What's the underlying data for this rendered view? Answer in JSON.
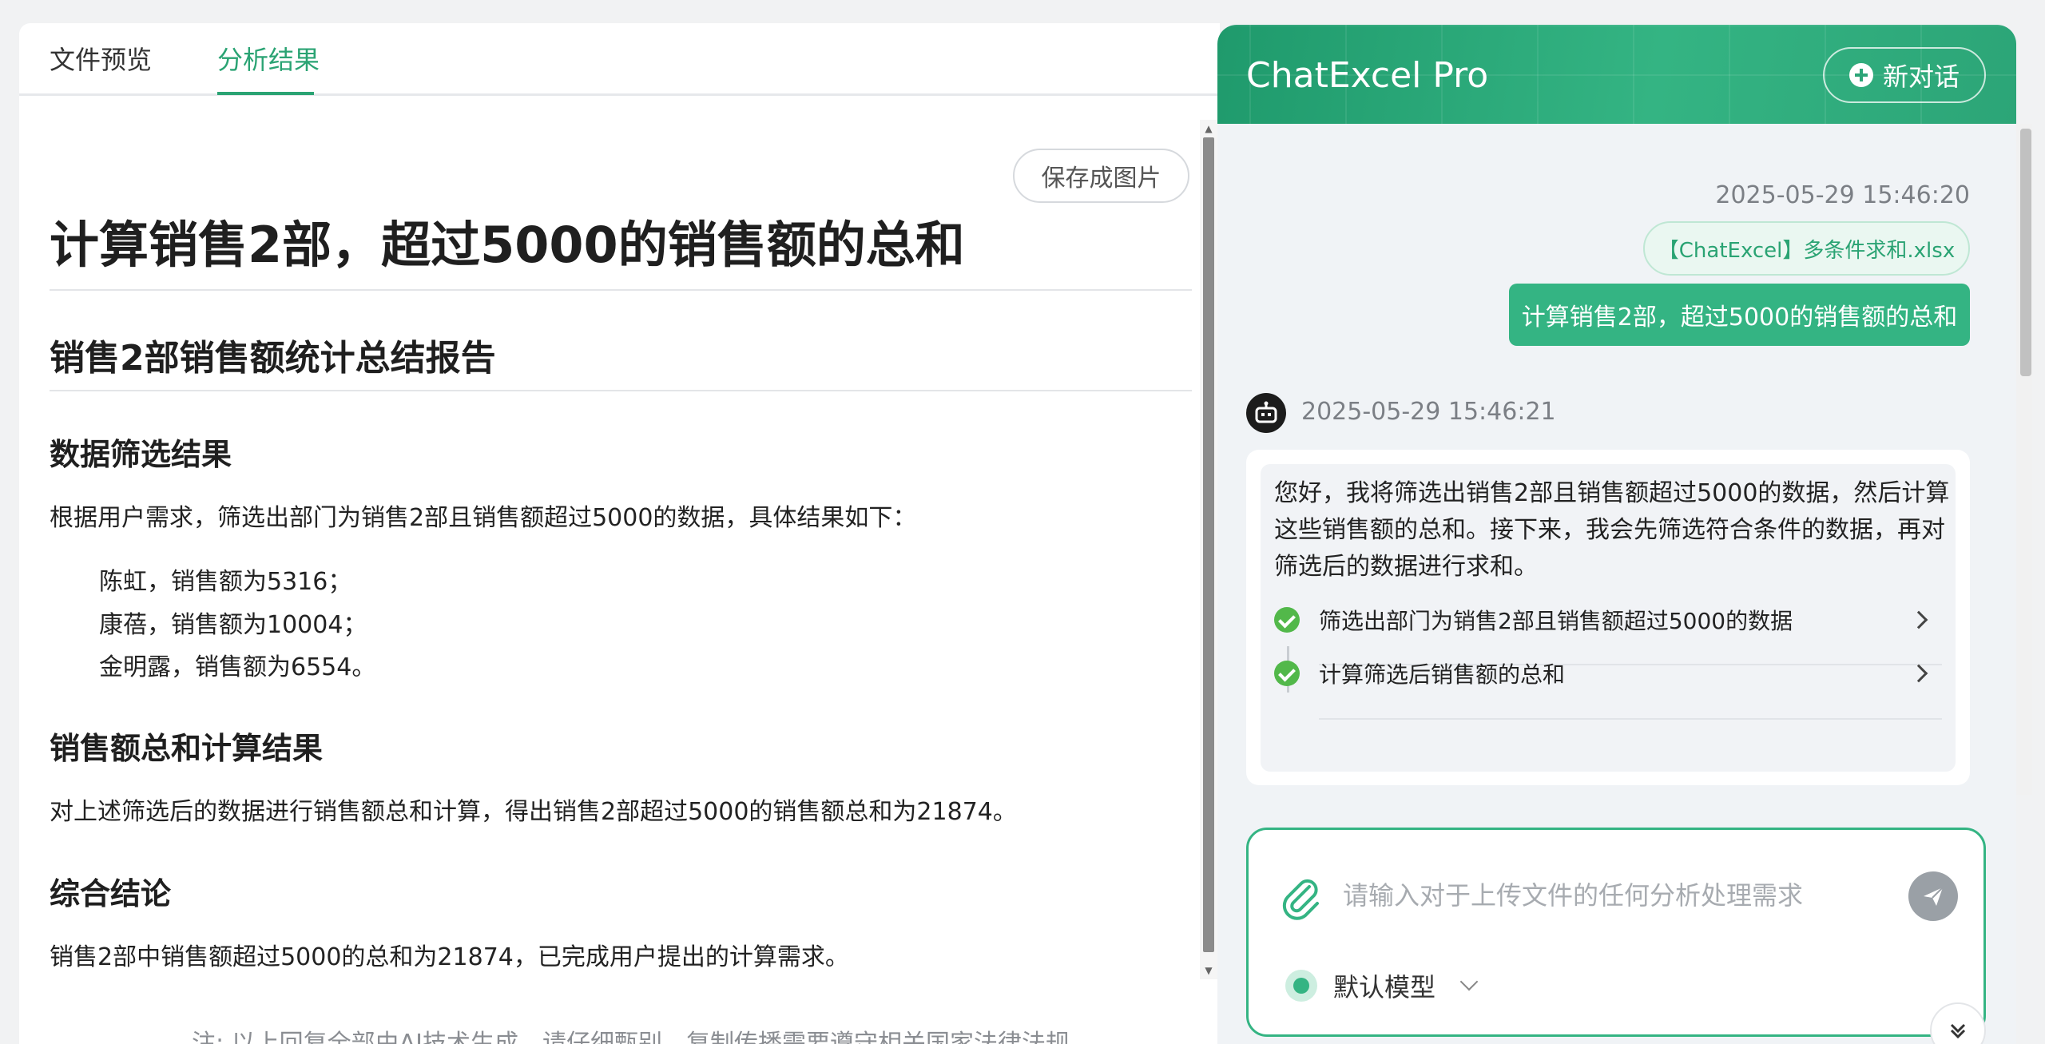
{
  "tabs": {
    "preview": "文件预览",
    "result": "分析结果"
  },
  "report": {
    "save_button": "保存成图片",
    "title": "计算销售2部，超过5000的销售额的总和",
    "subtitle": "销售2部销售额统计总结报告",
    "sections": [
      {
        "heading": "数据筛选结果",
        "text": "根据用户需求，筛选出部门为销售2部且销售额超过5000的数据，具体结果如下：",
        "items": [
          "陈虹，销售额为5316；",
          "康蓓，销售额为10004；",
          "金明露，销售额为6554。"
        ]
      },
      {
        "heading": "销售额总和计算结果",
        "text": "对上述筛选后的数据进行销售额总和计算，得出销售2部超过5000的销售额总和为21874。"
      },
      {
        "heading": "综合结论",
        "text": "销售2部中销售额超过5000的总和为21874，已完成用户提出的计算需求。"
      }
    ],
    "note": "注: 以上回复全部由AI技术生成，请仔细甄别，复制传播需要遵守相关国家法律法规"
  },
  "chat": {
    "title": "ChatExcel Pro",
    "new_chat": "新对话",
    "user_timestamp": "2025-05-29 15:46:20",
    "file_name": "【ChatExcel】多条件求和.xlsx",
    "user_message": "计算销售2部，超过5000的销售额的总和",
    "bot_timestamp": "2025-05-29 15:46:21",
    "bot_message": "您好，我将筛选出销售2部且销售额超过5000的数据，然后计算这些销售额的总和。接下来，我会先筛选符合条件的数据，再对筛选后的数据进行求和。",
    "steps": [
      "筛选出部门为销售2部且销售额超过5000的数据",
      "计算筛选后销售额的总和"
    ],
    "input_placeholder": "请输入对于上传文件的任何分析处理需求",
    "model": "默认模型"
  },
  "colors": {
    "accent": "#34b483",
    "accent_dark": "#2aa373",
    "success": "#52b84a"
  },
  "icons": [
    "plus-icon",
    "robot-icon",
    "check-icon",
    "chevron-right-icon",
    "paperclip-icon",
    "send-icon",
    "chevron-down-icon"
  ]
}
